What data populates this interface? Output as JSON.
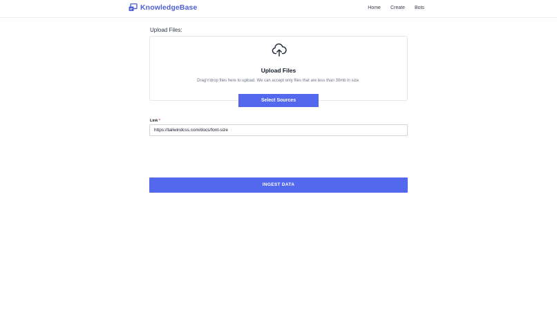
{
  "brand": {
    "name": "KnowledgeBase",
    "icon": "knowledge-base-logo-icon",
    "color": "#4c5fd5"
  },
  "nav": {
    "items": [
      {
        "label": "Home"
      },
      {
        "label": "Create"
      },
      {
        "label": "Bots"
      }
    ]
  },
  "upload": {
    "section_label": "Upload Files:",
    "icon": "cloud-upload-icon",
    "title": "Upload Files",
    "description": "Drag'n'drop files here to upload. We can accept only files that are less than 30mb in size.",
    "select_button_label": "Select Sources"
  },
  "link_field": {
    "label": "Link",
    "required_marker": "*",
    "value": "https://tailwindcss.com/docs/font-size"
  },
  "ingest_button_label": "INGEST DATA",
  "colors": {
    "accent": "#5468ee",
    "required": "#e53e3e"
  }
}
